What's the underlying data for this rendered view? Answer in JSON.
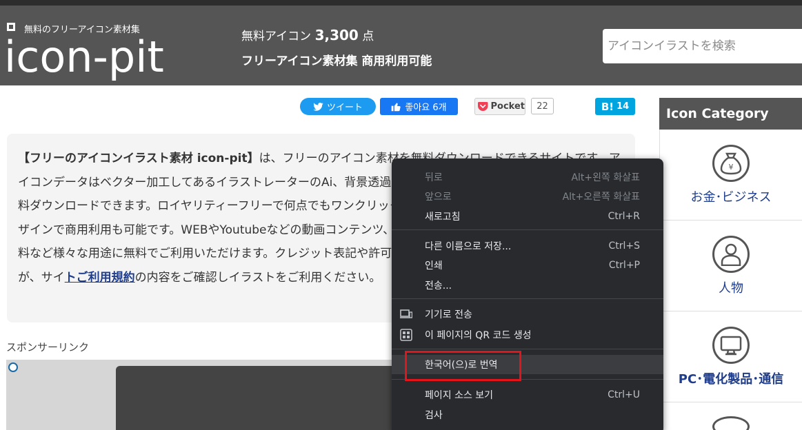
{
  "header": {
    "logo_tagline": "無料のフリーアイコン素材集",
    "logo_text": "icon-pit",
    "tagline_prefix": "無料アイコン",
    "icon_count": "3,300",
    "tagline_suffix": "点",
    "subtitle": "フリーアイコン素材集 商用利用可能",
    "search_placeholder": "アイコンイラストを検索"
  },
  "share": {
    "tweet_label": "ツイート",
    "like_label": "좋아요 6개",
    "pocket_label": "Pocket",
    "pocket_count": "22",
    "hatena_label": "B!",
    "hatena_count": "14"
  },
  "intro": {
    "lead": "【フリーのアイコンイラスト素材 icon-pit】",
    "body": "は、フリーのアイコン素材を無料ダウンロードできるサイトです。アイコンデータはベクター加工してあるイラストレーターのAi、背景透過のPNG、で配布しており会員登録不要で無料ダウンロードできます。ロイヤリティーフリーで何点でもワンクリックでダウンロードできます。汎用性が高いデザインで商用利用も可能です。WEBやYoutubeなどの動画コンテンツ、ポストカードやプレゼン資料、各種業務資料など様々な用途に無料でご利用いただけます。クレジット表記や許可も必要なく加工してご利用いただけますが、サイ",
    "link": "トご利用規約",
    "tail": "の内容をご確認しイラストをご利用ください。"
  },
  "sponsor_label": "スポンサーリンク",
  "sidebar": {
    "title": "Icon Category",
    "categories": [
      {
        "label": "お金･ビジネス",
        "icon": "money-bag-icon"
      },
      {
        "label": "人物",
        "icon": "person-icon"
      },
      {
        "label": "PC･電化製品･通信",
        "icon": "monitor-icon"
      }
    ]
  },
  "context_menu": {
    "items": [
      {
        "label": "뒤로",
        "shortcut": "Alt+왼쪽 화살표",
        "enabled": false
      },
      {
        "label": "앞으로",
        "shortcut": "Alt+오른쪽 화살표",
        "enabled": false
      },
      {
        "label": "새로고침",
        "shortcut": "Ctrl+R",
        "enabled": true
      },
      {
        "label": "다른 이름으로 저장...",
        "shortcut": "Ctrl+S",
        "enabled": true
      },
      {
        "label": "인쇄",
        "shortcut": "Ctrl+P",
        "enabled": true
      },
      {
        "label": "전송...",
        "shortcut": "",
        "enabled": true
      },
      {
        "label": "기기로 전송",
        "shortcut": "",
        "icon": "device-send-icon",
        "enabled": true
      },
      {
        "label": "이 페이지의 QR 코드 생성",
        "shortcut": "",
        "icon": "qr-code-icon",
        "enabled": true
      },
      {
        "label": "한국어(으)로 번역",
        "shortcut": "",
        "enabled": true,
        "highlighted": true
      },
      {
        "label": "페이지 소스 보기",
        "shortcut": "Ctrl+U",
        "enabled": true
      },
      {
        "label": "검사",
        "shortcut": "",
        "enabled": true
      }
    ]
  }
}
